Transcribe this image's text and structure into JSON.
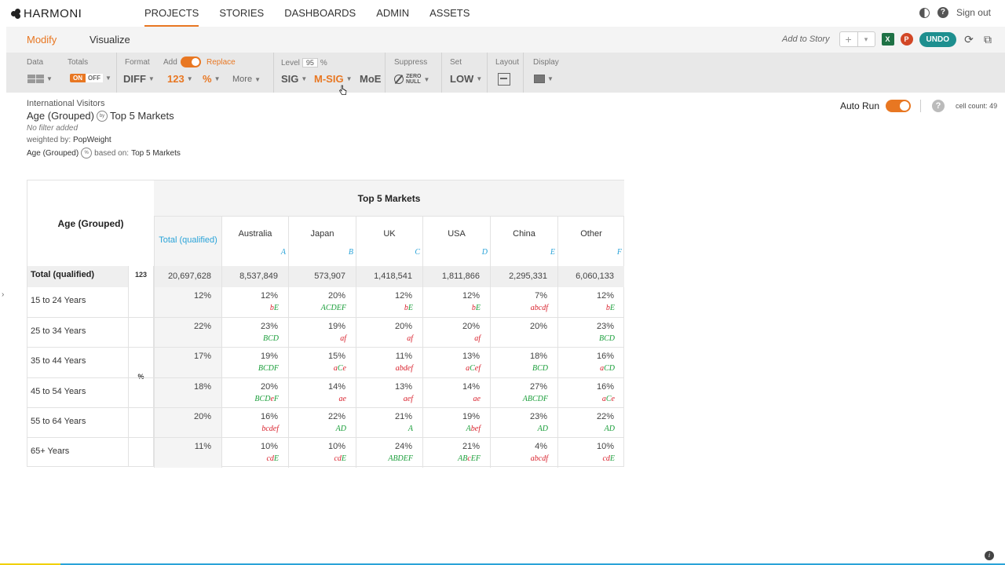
{
  "app": {
    "logo_text": "HARMONI"
  },
  "nav": {
    "items": [
      {
        "label": "PROJECTS",
        "active": true
      },
      {
        "label": "STORIES"
      },
      {
        "label": "DASHBOARDS"
      },
      {
        "label": "ADMIN"
      },
      {
        "label": "ASSETS"
      }
    ],
    "signout_label": "Sign out"
  },
  "subnav": {
    "modify_label": "Modify",
    "visualize_label": "Visualize",
    "add_to_story_label": "Add to Story",
    "excel_glyph": "X",
    "ppt_glyph": "P",
    "undo_label": "UNDO",
    "add_glyph": "+",
    "dropdown_glyph": "▾"
  },
  "toolbar": {
    "data_label": "Data",
    "totals_label": "Totals",
    "totals_on": "ON",
    "totals_off": "OFF",
    "format_label": "Format",
    "format_value": "DIFF",
    "add_label": "Add",
    "replace_label": "Replace",
    "add_value_123": "123",
    "add_value_pct": "%",
    "more_label": "More",
    "level_label": "Level",
    "level_value": "95",
    "level_unit": "%",
    "sig_label": "SIG",
    "msig_label": "M-SIG",
    "moe_label": "MoE",
    "suppress_label": "Suppress",
    "zero_label": "ZERO",
    "null_label": "NULL",
    "set_label": "Set",
    "set_value": "LOW",
    "layout_label": "Layout",
    "display_label": "Display"
  },
  "info": {
    "dataset": "International Visitors",
    "row_var": "Age (Grouped)",
    "col_var": "Top 5 Markets",
    "by_badge": "by",
    "filter_text": "No filter added",
    "weighted_prefix": "weighted by:",
    "weight_var": "PopWeight",
    "pct_badge": "%",
    "based_on_prefix": "based on:",
    "based_on_var": "Top 5 Markets",
    "base_row_var": "Age (Grouped)"
  },
  "autorun": {
    "label": "Auto Run",
    "help_glyph": "?",
    "cell_count_label": "cell count: 49"
  },
  "table": {
    "row_header": "Age (Grouped)",
    "col_group": "Top 5 Markets",
    "columns": [
      {
        "name": "Total (qualified)",
        "letter": ""
      },
      {
        "name": "Australia",
        "letter": "A"
      },
      {
        "name": "Japan",
        "letter": "B"
      },
      {
        "name": "UK",
        "letter": "C"
      },
      {
        "name": "USA",
        "letter": "D"
      },
      {
        "name": "China",
        "letter": "E"
      },
      {
        "name": "Other",
        "letter": "F"
      }
    ],
    "total_row": {
      "label": "Total (qualified)",
      "measure": "123",
      "values": [
        "20,697,628",
        "8,537,849",
        "573,907",
        "1,418,541",
        "1,811,866",
        "2,295,331",
        "6,060,133"
      ]
    },
    "pct_measure": "%",
    "rows": [
      {
        "label": "15 to 24 Years",
        "values": [
          "12%",
          "12%",
          "20%",
          "12%",
          "12%",
          "7%",
          "12%"
        ],
        "sigs": [
          "",
          "bE",
          "ACDEF",
          "bE",
          "bE",
          "abcdf",
          "bE"
        ]
      },
      {
        "label": "25 to 34 Years",
        "values": [
          "22%",
          "23%",
          "19%",
          "20%",
          "20%",
          "20%",
          "23%"
        ],
        "sigs": [
          "",
          "BCD",
          "af",
          "af",
          "af",
          "",
          "BCD"
        ]
      },
      {
        "label": "35 to 44 Years",
        "values": [
          "17%",
          "19%",
          "15%",
          "11%",
          "13%",
          "18%",
          "16%"
        ],
        "sigs": [
          "",
          "BCDF",
          "aCe",
          "abdef",
          "aCef",
          "BCD",
          "aCD"
        ]
      },
      {
        "label": "45 to 54 Years",
        "values": [
          "18%",
          "20%",
          "14%",
          "13%",
          "14%",
          "27%",
          "16%"
        ],
        "sigs": [
          "",
          "BCDeF",
          "ae",
          "aef",
          "ae",
          "ABCDF",
          "aCe"
        ]
      },
      {
        "label": "55 to 64 Years",
        "values": [
          "20%",
          "16%",
          "22%",
          "21%",
          "19%",
          "23%",
          "22%"
        ],
        "sigs": [
          "",
          "bcdef",
          "AD",
          "A",
          "Abef",
          "AD",
          "AD"
        ]
      },
      {
        "label": "65+ Years",
        "values": [
          "11%",
          "10%",
          "10%",
          "24%",
          "21%",
          "4%",
          "10%"
        ],
        "sigs": [
          "",
          "cdE",
          "cdE",
          "ABDEF",
          "ABcEF",
          "abcdf",
          "cdE"
        ]
      }
    ]
  },
  "colors": {
    "accent": "#e87722",
    "teal": "#1e8f8f",
    "sig_up": "#1a9e3a",
    "sig_down": "#d9232e",
    "letter": "#2aa3d8"
  }
}
